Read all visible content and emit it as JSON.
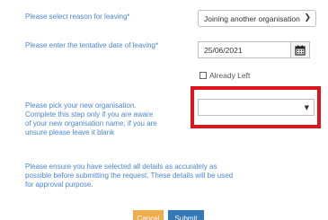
{
  "form": {
    "reason_label": "Please select reason for leaving*",
    "reason_value": "Joining another organisation",
    "date_label": "Please enter the tentative date of leaving*",
    "date_value": "25/06/2021",
    "already_left_label": "Already Left",
    "org_label": "Please pick your new organisation. Complete this step only if you are aware of your new organisation name, if you are unsure please leave it blank",
    "org_value": "",
    "note": "Please ensure you have selected all details as accurately as possible before submitting the request. These details will be used for approval purpose."
  },
  "buttons": {
    "cancel": "Cancel",
    "submit": "Submit"
  },
  "icons": {
    "reason_dropdown": "chevron-down-icon",
    "calendar": "calendar-icon",
    "org_dropdown": "caret-down-icon"
  },
  "colors": {
    "label": "#4a86d6",
    "highlight": "#e0141b",
    "cancel": "#f0ad4e",
    "submit": "#337ab7"
  }
}
